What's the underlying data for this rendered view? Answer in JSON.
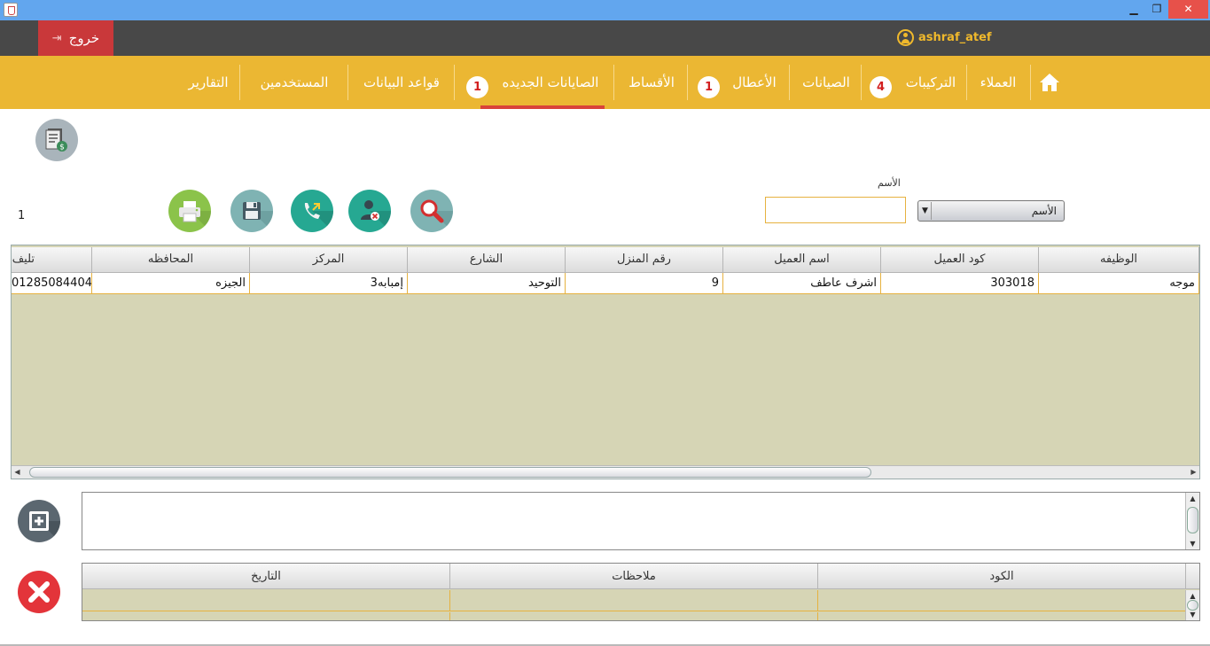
{
  "window": {
    "minimize": "▁",
    "maximize": "❐",
    "close": "✕"
  },
  "topbar": {
    "logout_label": "خروج",
    "username": "ashraf_atef"
  },
  "nav": {
    "items": [
      {
        "label": "العملاء"
      },
      {
        "label": "التركيبات",
        "badge": "4"
      },
      {
        "label": "الصيانات"
      },
      {
        "label": "الأعطال",
        "badge": "1"
      },
      {
        "label": "الأقساط"
      },
      {
        "label": "الصايانات الجديده",
        "badge": "1",
        "active": true
      },
      {
        "label": "قواعد البيانات"
      },
      {
        "label": "المستخدمين"
      },
      {
        "label": "التقارير"
      }
    ]
  },
  "search": {
    "field_label": "الأسم",
    "input_value": "",
    "select_value": "الأسم",
    "result_count": "1"
  },
  "customers_table": {
    "columns": [
      "الوظيفه",
      "كود العميل",
      "اسم العميل",
      "رقم المنزل",
      "الشارع",
      "المركز",
      "المحافظه",
      "تليف"
    ],
    "rows": [
      [
        "موجه",
        "303018",
        "اشرف عاطف",
        "9",
        "التوحيد",
        "إمبابه3",
        "الجيزه",
        "01285084404"
      ]
    ]
  },
  "notes": {
    "text": ""
  },
  "history_table": {
    "columns": [
      "الكود",
      "ملاحظات",
      "التاريخ"
    ]
  },
  "colors": {
    "titlebar": "#62a6ee",
    "topbar": "#484848",
    "logout": "#c9383a",
    "navbar": "#ebb733",
    "active_underline": "#d9433a",
    "username": "#f0b92c",
    "table_bg": "#d6d5b5",
    "cell_border": "#e6b240"
  },
  "icons": {
    "home": "home-icon",
    "logout": "exit-icon",
    "user": "user-icon",
    "invoice": "invoice-dollar-icon",
    "search": "magnifier-icon",
    "delete_user": "user-delete-icon",
    "call": "phone-call-icon",
    "save": "floppy-disk-icon",
    "print": "printer-icon",
    "add": "add-square-icon",
    "remove": "close-x-icon"
  }
}
